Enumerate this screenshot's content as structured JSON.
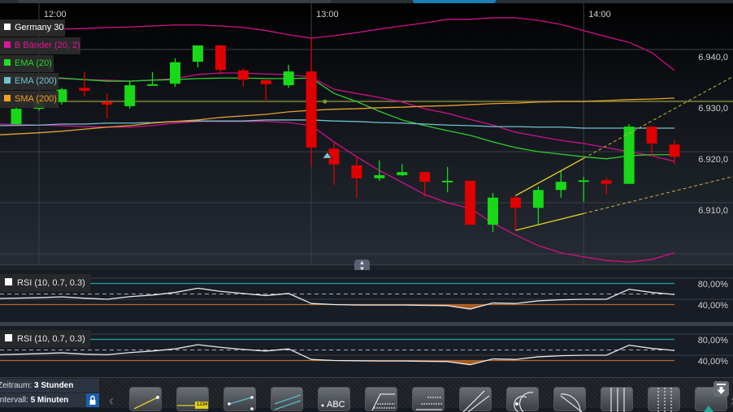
{
  "legend": [
    {
      "label": "Germany 30",
      "color": "#ffffff"
    },
    {
      "label": "B Bänder (20, 2)",
      "color": "#e0159a"
    },
    {
      "label": "EMA (20)",
      "color": "#22dd22"
    },
    {
      "label": "EMA (200)",
      "color": "#6ec3d0"
    },
    {
      "label": "SMA (200)",
      "color": "#f0a020"
    }
  ],
  "colors": {
    "up": "#18d818",
    "down": "#e00000",
    "band": "#d0108a",
    "ema20": "#2ecc2e",
    "ema200": "#6fc2cf",
    "sma200": "#e8a030",
    "hline": "#9aa020",
    "trend": "#e8d820",
    "rsi_high": "#1aa89a",
    "rsi_low": "#b86a30",
    "marker": "#7fc3d8"
  },
  "chart_data": {
    "type": "candlestick",
    "interval_minutes": 5,
    "x_labels": [
      {
        "slot": 1,
        "label": "12:00"
      },
      {
        "slot": 13,
        "label": "13:00"
      },
      {
        "slot": 25,
        "label": "14:00"
      }
    ],
    "y_ticks": [
      {
        "value": 6940,
        "label": "6.940,0"
      },
      {
        "value": 6930,
        "label": "6.930,0"
      },
      {
        "value": 6920,
        "label": "6.920,0"
      },
      {
        "value": 6910,
        "label": "6.910,0"
      }
    ],
    "ylim": [
      6898,
      6949
    ],
    "candles": [
      {
        "o": 6925.4,
        "h": 6928.7,
        "l": 6925.1,
        "c": 6928.4
      },
      {
        "o": 6928.4,
        "h": 6930.5,
        "l": 6928.0,
        "c": 6929.7
      },
      {
        "o": 6929.7,
        "h": 6932.5,
        "l": 6929.2,
        "c": 6932.2
      },
      {
        "o": 6932.5,
        "h": 6935.6,
        "l": 6930.8,
        "c": 6931.9
      },
      {
        "o": 6929.7,
        "h": 6931.4,
        "l": 6926.5,
        "c": 6929.2
      },
      {
        "o": 6928.9,
        "h": 6933.8,
        "l": 6928.4,
        "c": 6933.0
      },
      {
        "o": 6933.0,
        "h": 6935.6,
        "l": 6933.0,
        "c": 6933.2
      },
      {
        "o": 6933.3,
        "h": 6938.3,
        "l": 6932.7,
        "c": 6937.5
      },
      {
        "o": 6937.6,
        "h": 6940.8,
        "l": 6936.5,
        "c": 6940.8
      },
      {
        "o": 6940.8,
        "h": 6940.8,
        "l": 6935.1,
        "c": 6936.0
      },
      {
        "o": 6935.9,
        "h": 6936.3,
        "l": 6932.7,
        "c": 6934.1
      },
      {
        "o": 6934.0,
        "h": 6934.0,
        "l": 6929.7,
        "c": 6933.2
      },
      {
        "o": 6933.0,
        "h": 6937.0,
        "l": 6932.5,
        "c": 6935.7
      },
      {
        "o": 6935.7,
        "h": 6942.5,
        "l": 6917.1,
        "c": 6920.8
      },
      {
        "o": 6920.6,
        "h": 6921.7,
        "l": 6913.5,
        "c": 6917.5
      },
      {
        "o": 6917.3,
        "h": 6919.2,
        "l": 6911.0,
        "c": 6914.8
      },
      {
        "o": 6914.8,
        "h": 6918.3,
        "l": 6914.3,
        "c": 6915.4
      },
      {
        "o": 6915.4,
        "h": 6917.6,
        "l": 6915.2,
        "c": 6916.0
      },
      {
        "o": 6916.0,
        "h": 6916.0,
        "l": 6911.1,
        "c": 6914.1
      },
      {
        "o": 6914.1,
        "h": 6917.0,
        "l": 6912.1,
        "c": 6914.3
      },
      {
        "o": 6914.3,
        "h": 6914.3,
        "l": 6905.7,
        "c": 6905.7
      },
      {
        "o": 6905.7,
        "h": 6911.9,
        "l": 6904.3,
        "c": 6911.0
      },
      {
        "o": 6911.0,
        "h": 6911.4,
        "l": 6904.6,
        "c": 6909.0
      },
      {
        "o": 6909.0,
        "h": 6913.2,
        "l": 6905.7,
        "c": 6912.5
      },
      {
        "o": 6912.5,
        "h": 6916.3,
        "l": 6911.0,
        "c": 6914.1
      },
      {
        "o": 6914.3,
        "h": 6915.1,
        "l": 6910.2,
        "c": 6914.4
      },
      {
        "o": 6914.4,
        "h": 6914.9,
        "l": 6911.6,
        "c": 6913.7
      },
      {
        "o": 6913.7,
        "h": 6925.4,
        "l": 6913.7,
        "c": 6924.9
      },
      {
        "o": 6924.9,
        "h": 6924.9,
        "l": 6919.2,
        "c": 6921.6
      },
      {
        "o": 6921.4,
        "h": 6922.2,
        "l": 6917.5,
        "c": 6919.0
      }
    ],
    "series": [
      {
        "name": "B Bänder upper",
        "key": "band",
        "values": [
          6944.0,
          6944.0,
          6944.0,
          6944.1,
          6944.3,
          6944.4,
          6944.6,
          6944.8,
          6944.8,
          6944.6,
          6944.3,
          6943.7,
          6942.9,
          6942.2,
          6942.7,
          6943.3,
          6944.0,
          6944.6,
          6945.2,
          6945.9,
          6945.9,
          6946.2,
          6946.2,
          6945.7,
          6944.9,
          6943.7,
          6942.5,
          6941.4,
          6939.4,
          6935.9
        ]
      },
      {
        "name": "B Bänder middle",
        "key": "band",
        "values": [
          6934.3,
          6934.3,
          6934.3,
          6934.1,
          6934.0,
          6933.8,
          6934.0,
          6934.3,
          6935.1,
          6935.4,
          6935.4,
          6935.2,
          6935.1,
          6934.6,
          6932.2,
          6931.4,
          6930.6,
          6929.7,
          6928.4,
          6927.5,
          6926.3,
          6925.2,
          6923.8,
          6923.0,
          6922.2,
          6921.6,
          6920.8,
          6920.0,
          6919.2,
          6918.1
        ]
      },
      {
        "name": "B Bänder lower",
        "key": "band",
        "values": [
          6925.4,
          6925.2,
          6925.1,
          6924.9,
          6924.8,
          6924.8,
          6925.1,
          6925.6,
          6925.9,
          6925.9,
          6925.9,
          6925.9,
          6925.7,
          6925.1,
          6921.9,
          6919.0,
          6916.3,
          6914.0,
          6911.6,
          6910.0,
          6908.9,
          6906.0,
          6903.7,
          6901.6,
          6900.2,
          6899.4,
          6898.7,
          6898.4,
          6898.9,
          6900.2
        ]
      },
      {
        "name": "EMA (20)",
        "key": "ema20",
        "values": [
          6934.8,
          6934.6,
          6934.4,
          6934.1,
          6933.8,
          6933.8,
          6934.0,
          6934.1,
          6934.3,
          6934.4,
          6934.4,
          6934.3,
          6934.3,
          6934.4,
          6931.4,
          6929.8,
          6927.9,
          6926.2,
          6925.1,
          6924.1,
          6923.2,
          6921.9,
          6920.8,
          6920.0,
          6919.5,
          6919.0,
          6918.6,
          6919.2,
          6919.4,
          6919.4
        ]
      },
      {
        "name": "EMA (200)",
        "key": "ema200",
        "values": [
          6925.1,
          6925.2,
          6925.4,
          6925.4,
          6925.6,
          6925.6,
          6925.7,
          6925.9,
          6926.0,
          6926.0,
          6926.0,
          6926.2,
          6926.2,
          6926.2,
          6926.0,
          6925.9,
          6925.7,
          6925.6,
          6925.4,
          6925.2,
          6925.1,
          6924.9,
          6924.9,
          6924.8,
          6924.8,
          6924.6,
          6924.6,
          6924.6,
          6924.6,
          6924.6
        ]
      },
      {
        "name": "SMA (200)",
        "key": "sma200",
        "values": [
          6923.3,
          6923.7,
          6924.0,
          6924.4,
          6924.8,
          6925.1,
          6925.6,
          6925.9,
          6926.2,
          6926.7,
          6927.0,
          6927.3,
          6927.8,
          6928.1,
          6928.3,
          6928.4,
          6928.6,
          6928.7,
          6928.9,
          6929.0,
          6929.2,
          6929.4,
          6929.5,
          6929.7,
          6929.8,
          6929.8,
          6930.0,
          6930.2,
          6930.3,
          6930.5
        ]
      }
    ],
    "horizontal_line": 6929.8,
    "horizontal_line_dot_slot": 13.6,
    "trend_channel": {
      "upper": [
        {
          "slot": 22,
          "value": 6911.4
        },
        {
          "slot": 25,
          "value": 6918.7
        }
      ],
      "lower": [
        {
          "slot": 22,
          "value": 6904.6
        },
        {
          "slot": 25,
          "value": 6907.9
        }
      ],
      "extend_to_slot": 31.6
    },
    "marker": {
      "slot": 13.7,
      "value": 6919.3,
      "type": "buy-triangle"
    }
  },
  "rsi_panels": [
    {
      "label": "RSI (10, 0.7, 0.3)",
      "levels": {
        "high": 70,
        "mid": 50,
        "low": 30
      },
      "ticks": [
        {
          "value": 80,
          "label": "80,00%"
        },
        {
          "value": 40,
          "label": "40,00%"
        }
      ],
      "values": [
        41.5,
        43,
        44.6,
        42,
        40,
        45,
        48,
        53,
        61,
        55,
        51,
        47,
        51,
        32,
        30,
        29,
        29,
        29,
        28.5,
        28,
        21.5,
        33,
        32,
        37,
        39,
        40,
        40,
        59,
        53,
        49
      ]
    },
    {
      "label": "RSI (10, 0.7, 0.3)",
      "levels": {
        "high": 70,
        "mid": 50,
        "low": 30
      },
      "ticks": [
        {
          "value": 80,
          "label": "80,00%"
        },
        {
          "value": 40,
          "label": "40,00%"
        }
      ],
      "values": [
        41,
        43,
        44.5,
        42,
        41,
        45,
        48,
        52,
        60,
        55,
        51,
        48,
        52,
        32,
        30,
        29.5,
        29,
        29,
        28.5,
        28,
        22,
        33,
        32,
        37,
        39,
        40,
        40,
        59,
        53,
        49
      ]
    }
  ],
  "footer": {
    "zeitraum_label": "Zeitraum:",
    "zeitraum_value": "3 Stunden",
    "intervall_label": "Intervall:",
    "intervall_value": "5 Minuten",
    "tools": [
      {
        "name": "trendline-tool",
        "text": ""
      },
      {
        "name": "price-line-tool",
        "text": "1234"
      },
      {
        "name": "channel-tool",
        "text": ""
      },
      {
        "name": "parallel-channel-tool",
        "text": ""
      },
      {
        "name": "text-tool",
        "text": "ABC"
      },
      {
        "name": "fibonacci-retracement-tool",
        "text": ""
      },
      {
        "name": "fibonacci-extension-tool",
        "text": ""
      },
      {
        "name": "fan-tool",
        "text": ""
      },
      {
        "name": "fibonacci-arc-tool",
        "text": ""
      },
      {
        "name": "fibonacci-fan-tool",
        "text": ""
      },
      {
        "name": "vertical-lines-tool",
        "text": ""
      },
      {
        "name": "time-zones-tool",
        "text": ""
      },
      {
        "name": "more-tool",
        "text": ""
      }
    ]
  }
}
